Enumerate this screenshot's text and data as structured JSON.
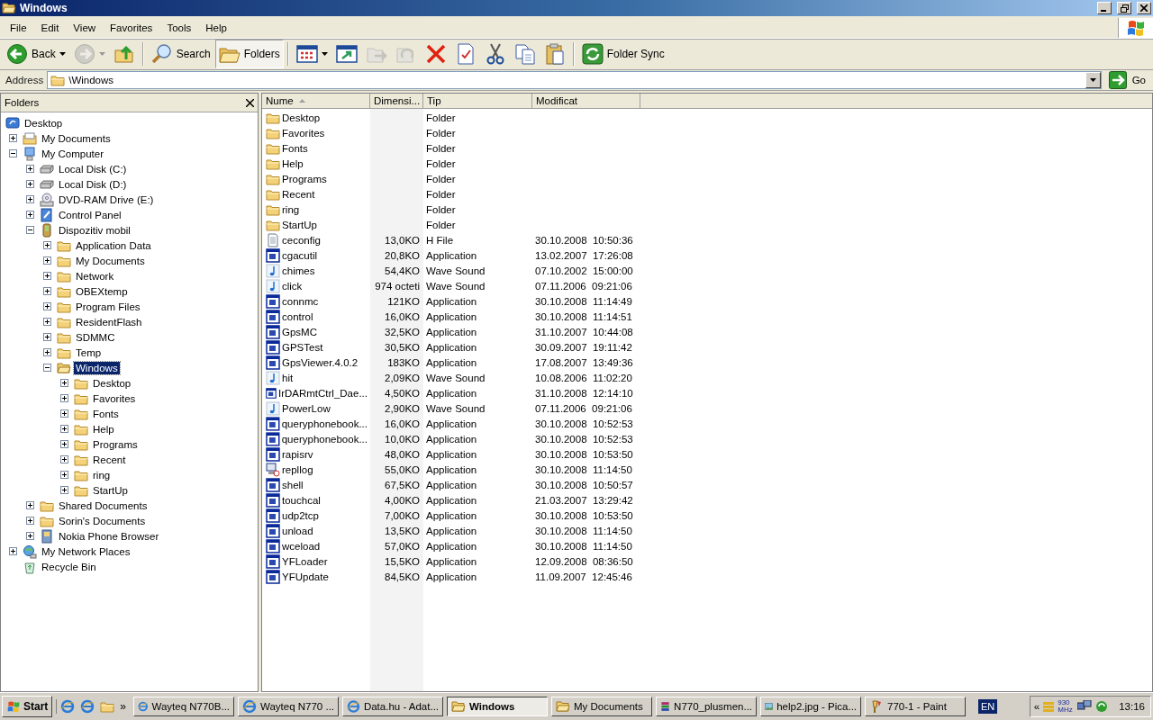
{
  "window": {
    "title": "Windows"
  },
  "menu": [
    "File",
    "Edit",
    "View",
    "Favorites",
    "Tools",
    "Help"
  ],
  "toolbar": [
    {
      "kind": "back",
      "label": "Back",
      "dropdown": true,
      "disabled": false,
      "pressed": false
    },
    {
      "kind": "forward",
      "dropdown": true,
      "disabled": true,
      "pressed": false
    },
    {
      "kind": "up",
      "dropdown": false,
      "disabled": false,
      "pressed": false
    },
    {
      "kind": "separator"
    },
    {
      "kind": "search",
      "label": "Search",
      "dropdown": false,
      "disabled": false,
      "pressed": false
    },
    {
      "kind": "folders",
      "label": "Folders",
      "dropdown": false,
      "disabled": false,
      "pressed": true
    },
    {
      "kind": "separator"
    },
    {
      "kind": "views",
      "dropdown": true,
      "disabled": false,
      "pressed": false
    },
    {
      "kind": "move",
      "dropdown": false,
      "disabled": false,
      "pressed": false
    },
    {
      "kind": "copyto",
      "dropdown": false,
      "disabled": true,
      "pressed": false
    },
    {
      "kind": "undo",
      "dropdown": false,
      "disabled": true,
      "pressed": false
    },
    {
      "kind": "delete",
      "dropdown": false,
      "disabled": false,
      "pressed": false
    },
    {
      "kind": "properties",
      "dropdown": false,
      "disabled": false,
      "pressed": false
    },
    {
      "kind": "cut",
      "dropdown": false,
      "disabled": false,
      "pressed": false
    },
    {
      "kind": "copy",
      "dropdown": false,
      "disabled": false,
      "pressed": false
    },
    {
      "kind": "paste",
      "dropdown": false,
      "disabled": false,
      "pressed": false
    },
    {
      "kind": "separator"
    },
    {
      "kind": "sync",
      "label": "Folder Sync",
      "dropdown": false,
      "disabled": false,
      "pressed": false
    }
  ],
  "address": {
    "label": "Address",
    "value": "\\Windows",
    "go": "Go"
  },
  "folders": {
    "title": "Folders",
    "tree": [
      {
        "label": "Desktop",
        "kind": "desktop",
        "selected": false,
        "children": [
          {
            "label": "My Documents",
            "kind": "documents",
            "expanded": false,
            "selected": false
          },
          {
            "label": "My Computer",
            "kind": "computer",
            "expanded": true,
            "selected": false,
            "children": [
              {
                "label": "Local Disk (C:)",
                "kind": "disk",
                "expanded": false,
                "selected": false
              },
              {
                "label": "Local Disk (D:)",
                "kind": "disk",
                "expanded": false,
                "selected": false
              },
              {
                "label": "DVD-RAM Drive (E:)",
                "kind": "dvd",
                "expanded": false,
                "selected": false
              },
              {
                "label": "Control Panel",
                "kind": "control",
                "expanded": false,
                "selected": false
              },
              {
                "label": "Dispozitiv mobil",
                "kind": "mobile",
                "expanded": true,
                "selected": false,
                "children": [
                  {
                    "label": "Application Data",
                    "kind": "folder",
                    "expanded": false,
                    "selected": false
                  },
                  {
                    "label": "My Documents",
                    "kind": "folder",
                    "expanded": false,
                    "selected": false
                  },
                  {
                    "label": "Network",
                    "kind": "folder",
                    "expanded": false,
                    "selected": false
                  },
                  {
                    "label": "OBEXtemp",
                    "kind": "folder",
                    "expanded": false,
                    "selected": false
                  },
                  {
                    "label": "Program Files",
                    "kind": "folder",
                    "expanded": false,
                    "selected": false
                  },
                  {
                    "label": "ResidentFlash",
                    "kind": "folder",
                    "expanded": false,
                    "selected": false
                  },
                  {
                    "label": "SDMMC",
                    "kind": "folder",
                    "expanded": false,
                    "selected": false
                  },
                  {
                    "label": "Temp",
                    "kind": "folder",
                    "expanded": false,
                    "selected": false
                  },
                  {
                    "label": "Windows",
                    "kind": "folder-open",
                    "expanded": true,
                    "selected": true,
                    "children": [
                      {
                        "label": "Desktop",
                        "kind": "folder",
                        "expanded": false,
                        "selected": false
                      },
                      {
                        "label": "Favorites",
                        "kind": "folder",
                        "expanded": false,
                        "selected": false
                      },
                      {
                        "label": "Fonts",
                        "kind": "folder",
                        "expanded": false,
                        "selected": false
                      },
                      {
                        "label": "Help",
                        "kind": "folder",
                        "expanded": false,
                        "selected": false
                      },
                      {
                        "label": "Programs",
                        "kind": "folder",
                        "expanded": false,
                        "selected": false
                      },
                      {
                        "label": "Recent",
                        "kind": "folder",
                        "expanded": false,
                        "selected": false
                      },
                      {
                        "label": "ring",
                        "kind": "folder",
                        "expanded": false,
                        "selected": false
                      },
                      {
                        "label": "StartUp",
                        "kind": "folder",
                        "expanded": false,
                        "selected": false
                      }
                    ]
                  }
                ]
              },
              {
                "label": "Shared Documents",
                "kind": "folder",
                "expanded": false,
                "selected": false
              },
              {
                "label": "Sorin's Documents",
                "kind": "folder",
                "expanded": false,
                "selected": false
              },
              {
                "label": "Nokia Phone Browser",
                "kind": "phone",
                "expanded": false,
                "selected": false
              }
            ]
          },
          {
            "label": "My Network Places",
            "kind": "network",
            "expanded": false,
            "selected": false
          },
          {
            "label": "Recycle Bin",
            "kind": "recycle",
            "selected": false
          }
        ]
      }
    ]
  },
  "files": {
    "columns": [
      {
        "label": "Nume",
        "sorted": true,
        "shaded": false
      },
      {
        "label": "Dimensi...",
        "sorted": false,
        "shaded": true
      },
      {
        "label": "Tip",
        "sorted": false,
        "shaded": false
      },
      {
        "label": "Modificat",
        "sorted": false,
        "shaded": false
      }
    ],
    "rows": [
      {
        "kind": "folder",
        "name": "Desktop",
        "type": "Folder"
      },
      {
        "kind": "folder",
        "name": "Favorites",
        "type": "Folder"
      },
      {
        "kind": "folder",
        "name": "Fonts",
        "type": "Folder"
      },
      {
        "kind": "folder",
        "name": "Help",
        "type": "Folder"
      },
      {
        "kind": "folder",
        "name": "Programs",
        "type": "Folder"
      },
      {
        "kind": "folder",
        "name": "Recent",
        "type": "Folder"
      },
      {
        "kind": "folder",
        "name": "ring",
        "type": "Folder"
      },
      {
        "kind": "folder",
        "name": "StartUp",
        "type": "Folder"
      },
      {
        "kind": "text",
        "name": "ceconfig",
        "size": "13,0KO",
        "type": "H File",
        "modified": "30.10.2008  10:50:36"
      },
      {
        "kind": "app",
        "name": "cgacutil",
        "size": "20,8KO",
        "type": "Application",
        "modified": "13.02.2007  17:26:08"
      },
      {
        "kind": "sound",
        "name": "chimes",
        "size": "54,4KO",
        "type": "Wave Sound",
        "modified": "07.10.2002  15:00:00"
      },
      {
        "kind": "sound",
        "name": "click",
        "size": "974 octeti",
        "type": "Wave Sound",
        "modified": "07.11.2006  09:21:06"
      },
      {
        "kind": "app",
        "name": "connmc",
        "size": "121KO",
        "type": "Application",
        "modified": "30.10.2008  11:14:49"
      },
      {
        "kind": "app",
        "name": "control",
        "size": "16,0KO",
        "type": "Application",
        "modified": "30.10.2008  11:14:51"
      },
      {
        "kind": "app",
        "name": "GpsMC",
        "size": "32,5KO",
        "type": "Application",
        "modified": "31.10.2007  10:44:08"
      },
      {
        "kind": "app",
        "name": "GPSTest",
        "size": "30,5KO",
        "type": "Application",
        "modified": "30.09.2007  19:11:42"
      },
      {
        "kind": "app",
        "name": "GpsViewer.4.0.2",
        "size": "183KO",
        "type": "Application",
        "modified": "17.08.2007  13:49:36"
      },
      {
        "kind": "sound",
        "name": "hit",
        "size": "2,09KO",
        "type": "Wave Sound",
        "modified": "10.08.2006  11:02:20"
      },
      {
        "kind": "app",
        "name": "IrDARmtCtrl_Dae...",
        "size": "4,50KO",
        "type": "Application",
        "modified": "31.10.2008  12:14:10"
      },
      {
        "kind": "sound",
        "name": "PowerLow",
        "size": "2,90KO",
        "type": "Wave Sound",
        "modified": "07.11.2006  09:21:06"
      },
      {
        "kind": "app",
        "name": "queryphonebook...",
        "size": "16,0KO",
        "type": "Application",
        "modified": "30.10.2008  10:52:53"
      },
      {
        "kind": "app",
        "name": "queryphonebook...",
        "size": "10,0KO",
        "type": "Application",
        "modified": "30.10.2008  10:52:53"
      },
      {
        "kind": "app",
        "name": "rapisrv",
        "size": "48,0KO",
        "type": "Application",
        "modified": "30.10.2008  10:53:50"
      },
      {
        "kind": "computer-app",
        "name": "repllog",
        "size": "55,0KO",
        "type": "Application",
        "modified": "30.10.2008  11:14:50"
      },
      {
        "kind": "app",
        "name": "shell",
        "size": "67,5KO",
        "type": "Application",
        "modified": "30.10.2008  10:50:57"
      },
      {
        "kind": "app",
        "name": "touchcal",
        "size": "4,00KO",
        "type": "Application",
        "modified": "21.03.2007  13:29:42"
      },
      {
        "kind": "app",
        "name": "udp2tcp",
        "size": "7,00KO",
        "type": "Application",
        "modified": "30.10.2008  10:53:50"
      },
      {
        "kind": "app",
        "name": "unload",
        "size": "13,5KO",
        "type": "Application",
        "modified": "30.10.2008  11:14:50"
      },
      {
        "kind": "app",
        "name": "wceload",
        "size": "57,0KO",
        "type": "Application",
        "modified": "30.10.2008  11:14:50"
      },
      {
        "kind": "app",
        "name": "YFLoader",
        "size": "15,5KO",
        "type": "Application",
        "modified": "12.09.2008  08:36:50"
      },
      {
        "kind": "app",
        "name": "YFUpdate",
        "size": "84,5KO",
        "type": "Application",
        "modified": "11.09.2007  12:45:46"
      }
    ]
  },
  "taskbar": {
    "start": "Start",
    "more": "»",
    "tasks": [
      {
        "kind": "browser",
        "label": "Wayteq N770B...",
        "selected": false
      },
      {
        "kind": "browser",
        "label": "Wayteq N770 ...",
        "selected": false
      },
      {
        "kind": "browser",
        "label": "Data.hu - Adat...",
        "selected": false
      },
      {
        "kind": "folder-open",
        "label": "Windows",
        "selected": true
      },
      {
        "kind": "folder-open",
        "label": "My Documents",
        "selected": false
      },
      {
        "kind": "archive",
        "label": "N770_plusmen...",
        "selected": false
      },
      {
        "kind": "image",
        "label": "help2.jpg - Pica...",
        "selected": false
      },
      {
        "kind": "paint",
        "label": "770-1 - Paint",
        "selected": false
      }
    ],
    "language": "EN",
    "tray_expand": "«",
    "cpu": "930 MHz",
    "clock": "13:16"
  }
}
